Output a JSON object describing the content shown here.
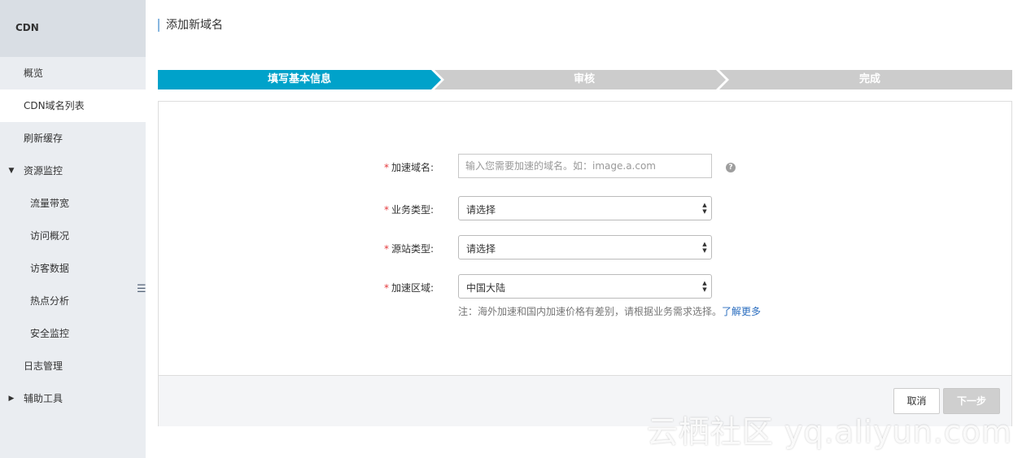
{
  "sidebar": {
    "title": "CDN",
    "items": [
      {
        "label": "概览"
      },
      {
        "label": "CDN域名列表"
      },
      {
        "label": "刷新缓存"
      },
      {
        "label": "资源监控",
        "caret": "▼"
      },
      {
        "label": "流量带宽"
      },
      {
        "label": "访问概况"
      },
      {
        "label": "访客数据"
      },
      {
        "label": "热点分析"
      },
      {
        "label": "安全监控"
      },
      {
        "label": "日志管理"
      },
      {
        "label": "辅助工具",
        "caret": "▶"
      }
    ],
    "toggle_icon": "☰"
  },
  "page": {
    "title": "添加新域名"
  },
  "steps": [
    {
      "label": "填写基本信息",
      "state": "active"
    },
    {
      "label": "审核",
      "state": "pending"
    },
    {
      "label": "完成",
      "state": "pending"
    }
  ],
  "form": {
    "required_mark": "*",
    "domain": {
      "label": "加速域名:",
      "placeholder": "输入您需要加速的域名。如：image.a.com",
      "value": ""
    },
    "help_icon": "?",
    "business_type": {
      "label": "业务类型:",
      "value": "请选择"
    },
    "origin_type": {
      "label": "源站类型:",
      "value": "请选择"
    },
    "region": {
      "label": "加速区域:",
      "value": "中国大陆"
    },
    "note": "注：海外加速和国内加速价格有差别，请根据业务需求选择。",
    "note_link": "了解更多"
  },
  "buttons": {
    "cancel": "取消",
    "next": "下一步"
  },
  "watermark": "云栖社区 yq.aliyun.com",
  "colors": {
    "step_active": "#00a2ca",
    "step_pending": "#cccccc",
    "required": "#e4393c",
    "link": "#2a6dbf"
  }
}
